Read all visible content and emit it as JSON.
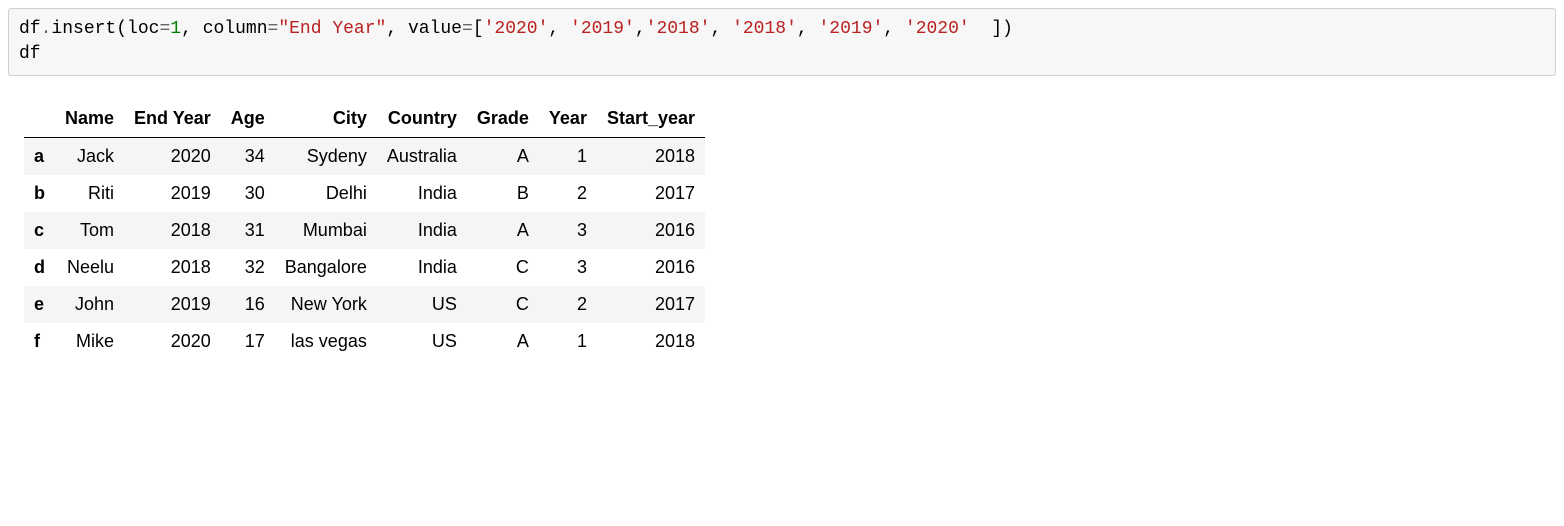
{
  "code": {
    "t_df1": "df",
    "t_dot1": ".",
    "t_insert": "insert",
    "t_paren_open": "(",
    "t_loc": "loc",
    "t_eq1": "=",
    "t_locval": "1",
    "t_comma1": ", ",
    "t_column": "column",
    "t_eq2": "=",
    "t_columnval": "\"End Year\"",
    "t_comma2": ", ",
    "t_value": "value",
    "t_eq3": "=",
    "t_bracket_open": "[",
    "t_v0": "'2020'",
    "t_c0": ", ",
    "t_v1": "'2019'",
    "t_c1": ",",
    "t_v2": "'2018'",
    "t_c2": ", ",
    "t_v3": "'2018'",
    "t_c3": ", ",
    "t_v4": "'2019'",
    "t_c4": ", ",
    "t_v5": "'2020'",
    "t_space_after": "  ",
    "t_bracket_close": "]",
    "t_paren_close": ")",
    "t_df2": "df"
  },
  "table": {
    "columns": [
      "Name",
      "End Year",
      "Age",
      "City",
      "Country",
      "Grade",
      "Year",
      "Start_year"
    ],
    "index": [
      "a",
      "b",
      "c",
      "d",
      "e",
      "f"
    ],
    "rows": [
      [
        "Jack",
        "2020",
        "34",
        "Sydeny",
        "Australia",
        "A",
        "1",
        "2018"
      ],
      [
        "Riti",
        "2019",
        "30",
        "Delhi",
        "India",
        "B",
        "2",
        "2017"
      ],
      [
        "Tom",
        "2018",
        "31",
        "Mumbai",
        "India",
        "A",
        "3",
        "2016"
      ],
      [
        "Neelu",
        "2018",
        "32",
        "Bangalore",
        "India",
        "C",
        "3",
        "2016"
      ],
      [
        "John",
        "2019",
        "16",
        "New York",
        "US",
        "C",
        "2",
        "2017"
      ],
      [
        "Mike",
        "2020",
        "17",
        "las vegas",
        "US",
        "A",
        "1",
        "2018"
      ]
    ]
  }
}
